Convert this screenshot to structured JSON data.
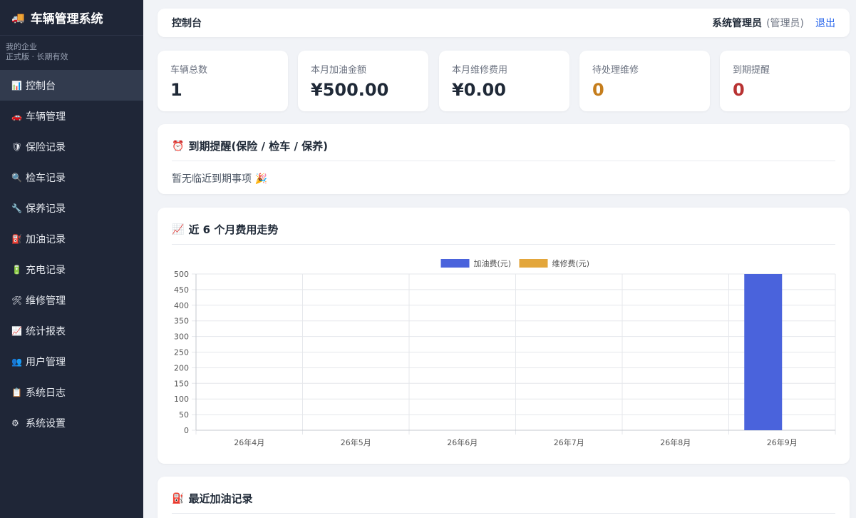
{
  "sidebar": {
    "brand_icon": "truck-icon",
    "brand_title": "车辆管理系统",
    "org_name": "我的企业",
    "edition": "正式版 · 长期有效",
    "items": [
      {
        "icon": "📊",
        "label": "控制台",
        "active": true
      },
      {
        "icon": "🚗",
        "label": "车辆管理"
      },
      {
        "icon": "🛡",
        "label": "保险记录"
      },
      {
        "icon": "🔍",
        "label": "检车记录"
      },
      {
        "icon": "🔧",
        "label": "保养记录"
      },
      {
        "icon": "⛽",
        "label": "加油记录"
      },
      {
        "icon": "🔋",
        "label": "充电记录"
      },
      {
        "icon": "🛠",
        "label": "维修管理"
      },
      {
        "icon": "📈",
        "label": "统计报表"
      },
      {
        "icon": "👥",
        "label": "用户管理"
      },
      {
        "icon": "📋",
        "label": "系统日志"
      },
      {
        "icon": "⚙",
        "label": "系统设置"
      }
    ]
  },
  "header": {
    "title": "控制台",
    "user_name": "系统管理员",
    "user_role": "(管理员)",
    "logout": "退出"
  },
  "stats": [
    {
      "label": "车辆总数",
      "value": "1",
      "color": "#1f2937"
    },
    {
      "label": "本月加油金额",
      "value": "¥500.00",
      "color": "#1f2937"
    },
    {
      "label": "本月维修费用",
      "value": "¥0.00",
      "color": "#1f2937"
    },
    {
      "label": "待处理维修",
      "value": "0",
      "color": "#c57d1c"
    },
    {
      "label": "到期提醒",
      "value": "0",
      "color": "#b83232"
    }
  ],
  "reminder": {
    "icon": "⏰",
    "title": "到期提醒(保险 / 检车 / 保养)",
    "empty_text": "暂无临近到期事项 🎉"
  },
  "trend": {
    "icon": "📈",
    "title": "近 6 个月费用走势"
  },
  "recent": {
    "icon": "⛽",
    "title": "最近加油记录"
  },
  "chart_data": {
    "type": "bar",
    "categories": [
      "26年4月",
      "26年5月",
      "26年6月",
      "26年7月",
      "26年8月",
      "26年9月"
    ],
    "series": [
      {
        "name": "加油费(元)",
        "values": [
          0,
          0,
          0,
          0,
          0,
          500
        ],
        "color": "#4a63dc"
      },
      {
        "name": "维修费(元)",
        "values": [
          0,
          0,
          0,
          0,
          0,
          0
        ],
        "color": "#e3a63b"
      }
    ],
    "ylim": [
      0,
      500
    ],
    "yticks": [
      0,
      50,
      100,
      150,
      200,
      250,
      300,
      350,
      400,
      450,
      500
    ],
    "grid": true,
    "legend": "top-center"
  }
}
